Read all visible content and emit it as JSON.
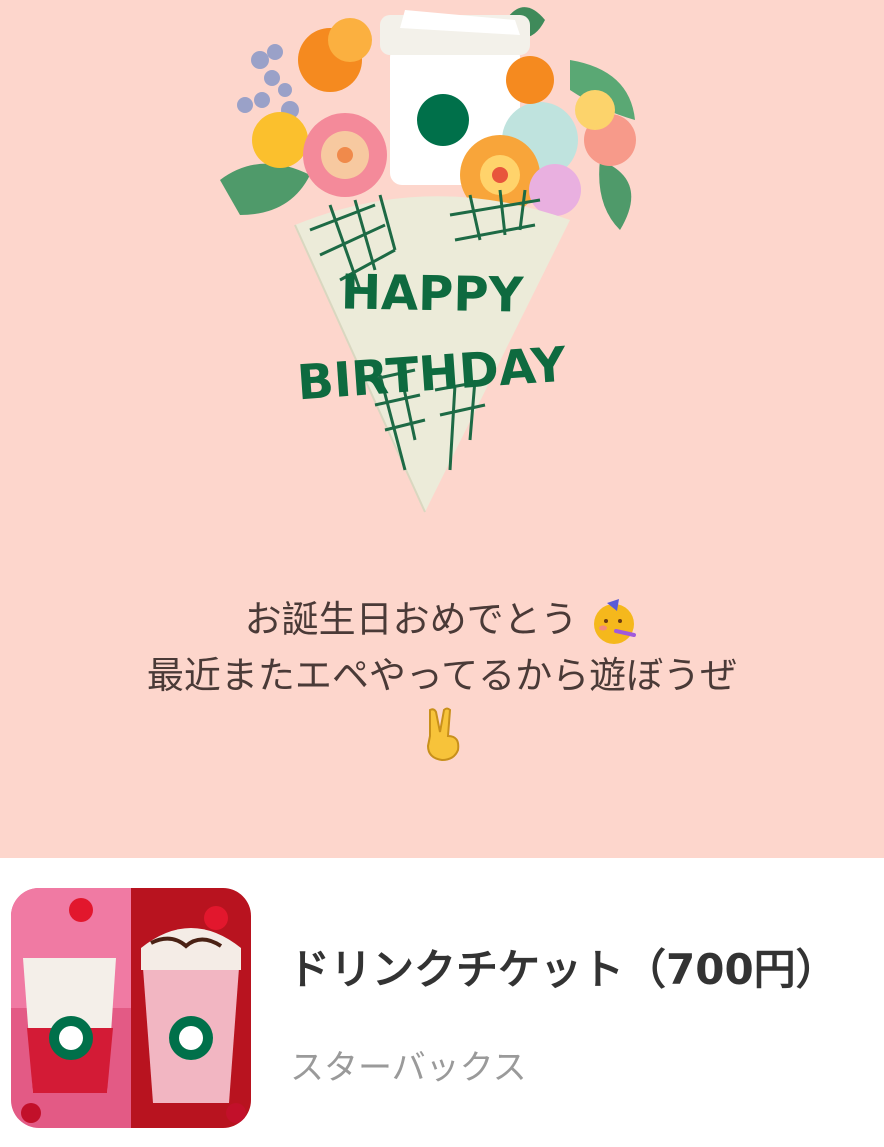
{
  "card": {
    "background": "#fdd6cc",
    "illustration_text_line1": "HAPPY",
    "illustration_text_line2": "BIRTHDAY",
    "message_line1": "お誕生日おめでとう",
    "message_emoji1": "partying-face-emoji",
    "message_line2": "最近またエペやってるから遊ぼうぜ",
    "message_emoji2": "victory-hand-emoji"
  },
  "ticket": {
    "title": "ドリンクチケット（700円）",
    "brand": "スターバックス",
    "image": "strawberry-frappuccino-image"
  },
  "colors": {
    "brand_green": "#00704a",
    "text_dark": "#4a3a37",
    "title": "#333333",
    "subtitle": "#9a9a9a"
  }
}
